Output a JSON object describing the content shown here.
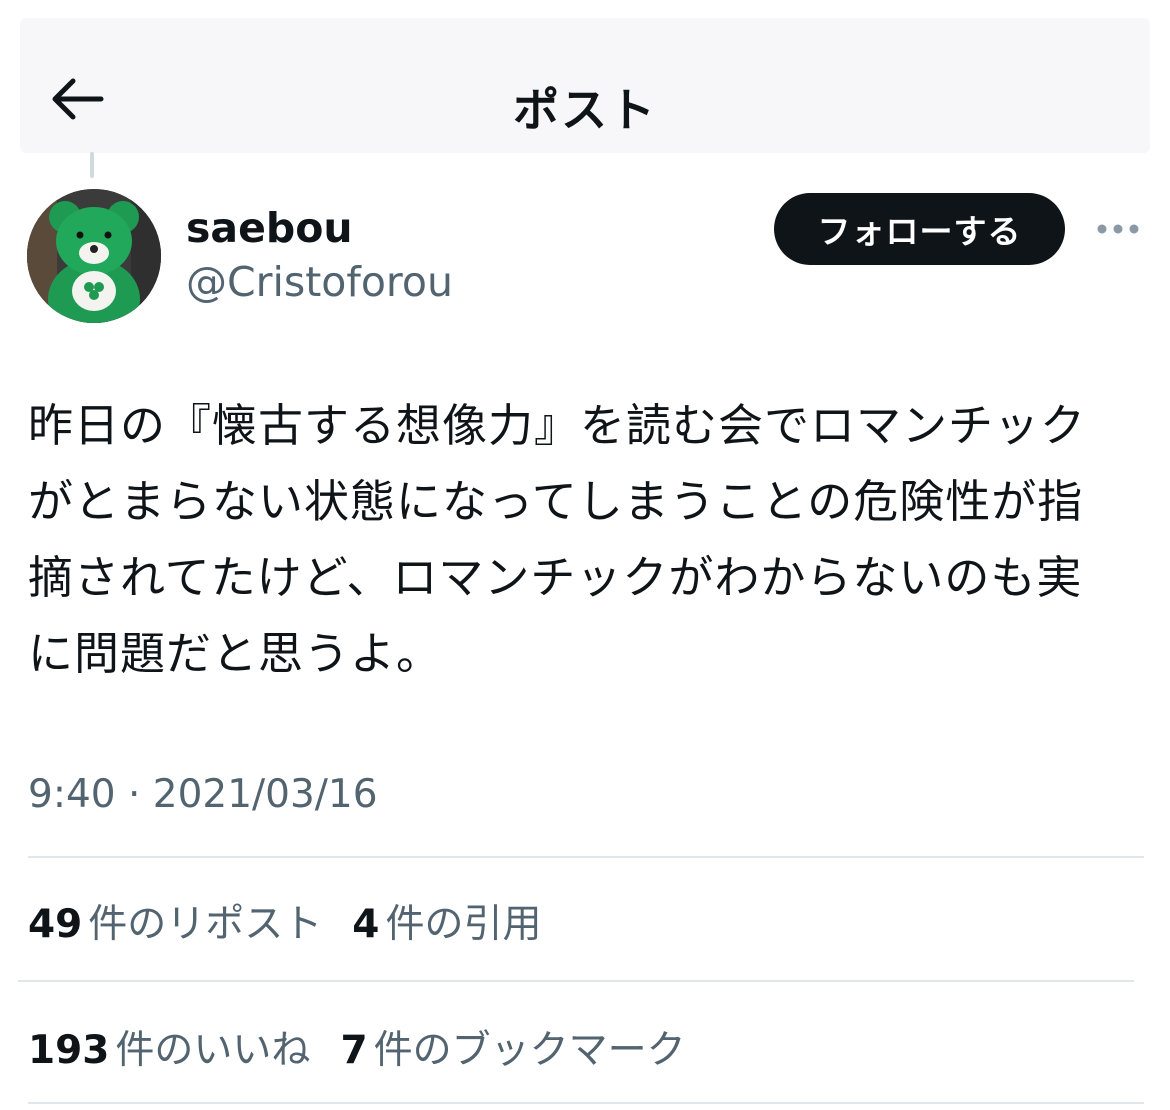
{
  "header": {
    "title": "ポスト",
    "back_icon": "arrow-left-icon"
  },
  "author": {
    "display_name": "saebou",
    "handle": "@Cristoforou",
    "avatar_icon": "green-teddy-bear-avatar"
  },
  "follow_button": {
    "label": "フォローする"
  },
  "more_icon": "more-horizontal-icon",
  "post": {
    "lines": [
      "昨日の『懐古する想像力』を読む会でロマンチック",
      "がとまらない状態になってしまうことの危険性が指",
      "摘されてたけど、ロマンチックがわからないのも実",
      "に問題だと思うよ。"
    ]
  },
  "timestamp": "9:40 · 2021/03/16",
  "stats": {
    "reposts": {
      "count": "49",
      "label": "件のリポスト"
    },
    "quotes": {
      "count": "4",
      "label": "件の引用"
    },
    "likes": {
      "count": "193",
      "label": "件のいいね"
    },
    "bookmarks": {
      "count": "7",
      "label": "件のブックマーク"
    }
  },
  "colors": {
    "text_primary": "#0f1419",
    "text_secondary": "#536471",
    "follow_button_bg": "#0f1419",
    "divider": "#e1e6ea"
  }
}
